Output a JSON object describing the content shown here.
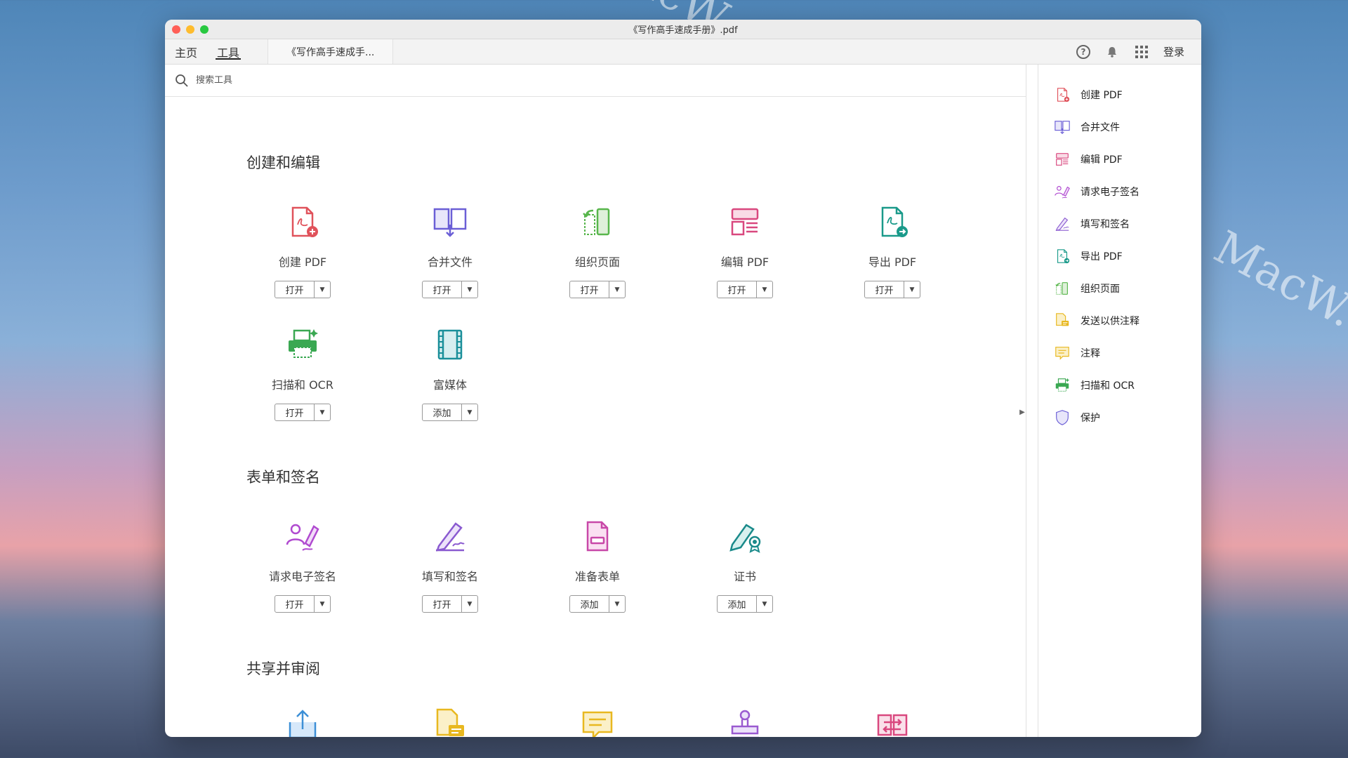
{
  "window": {
    "title": "《写作高手速成手册》.pdf"
  },
  "menubar": {
    "tabs": [
      {
        "label": "主页"
      },
      {
        "label": "工具"
      }
    ],
    "doc_tab": "《写作高手速成手...",
    "help_icon": "question-circle-icon",
    "help_glyph": "?",
    "login": "登录"
  },
  "search": {
    "placeholder": "搜索工具"
  },
  "sections": [
    {
      "title": "创建和编辑",
      "tools": [
        {
          "label": "创建 PDF",
          "button": "打开",
          "icon": "create-pdf-icon",
          "color": "#e0525b"
        },
        {
          "label": "合并文件",
          "button": "打开",
          "icon": "combine-files-icon",
          "color": "#6b5fd6"
        },
        {
          "label": "组织页面",
          "button": "打开",
          "icon": "organize-pages-icon",
          "color": "#58b64c"
        },
        {
          "label": "编辑 PDF",
          "button": "打开",
          "icon": "edit-pdf-icon",
          "color": "#d9487f"
        },
        {
          "label": "导出 PDF",
          "button": "打开",
          "icon": "export-pdf-icon",
          "color": "#1a9a8a"
        },
        {
          "label": "扫描和 OCR",
          "button": "打开",
          "icon": "scan-ocr-icon",
          "color": "#3aa852"
        },
        {
          "label": "富媒体",
          "button": "添加",
          "icon": "rich-media-icon",
          "color": "#1a8f9a"
        }
      ]
    },
    {
      "title": "表单和签名",
      "tools": [
        {
          "label": "请求电子签名",
          "button": "打开",
          "icon": "request-esign-icon",
          "color": "#b04ad0"
        },
        {
          "label": "填写和签名",
          "button": "打开",
          "icon": "fill-sign-icon",
          "color": "#8a5ad0"
        },
        {
          "label": "准备表单",
          "button": "添加",
          "icon": "prepare-form-icon",
          "color": "#c848a8"
        },
        {
          "label": "证书",
          "button": "添加",
          "icon": "certificate-icon",
          "color": "#1a8a8a"
        }
      ]
    },
    {
      "title": "共享并审阅",
      "tools": [
        {
          "label": "",
          "icon": "share-icon",
          "color": "#3d8fd6"
        },
        {
          "label": "",
          "icon": "send-comment-icon",
          "color": "#e8b820"
        },
        {
          "label": "",
          "icon": "comment-icon",
          "color": "#e8b820"
        },
        {
          "label": "",
          "icon": "stamp-icon",
          "color": "#9a5ad0"
        },
        {
          "label": "",
          "icon": "compare-icon",
          "color": "#d9487f"
        }
      ]
    }
  ],
  "sidebar": {
    "items": [
      {
        "label": "创建 PDF",
        "icon": "create-pdf-icon",
        "color": "#e0525b"
      },
      {
        "label": "合并文件",
        "icon": "combine-files-icon",
        "color": "#6b5fd6"
      },
      {
        "label": "编辑 PDF",
        "icon": "edit-pdf-icon",
        "color": "#d9487f"
      },
      {
        "label": "请求电子签名",
        "icon": "request-esign-icon",
        "color": "#b04ad0"
      },
      {
        "label": "填写和签名",
        "icon": "fill-sign-icon",
        "color": "#8a5ad0"
      },
      {
        "label": "导出 PDF",
        "icon": "export-pdf-icon",
        "color": "#1a9a8a"
      },
      {
        "label": "组织页面",
        "icon": "organize-pages-icon",
        "color": "#58b64c"
      },
      {
        "label": "发送以供注释",
        "icon": "send-comment-icon",
        "color": "#e8b820"
      },
      {
        "label": "注释",
        "icon": "comment-icon",
        "color": "#e8b820"
      },
      {
        "label": "扫描和 OCR",
        "icon": "scan-ocr-icon",
        "color": "#3aa852"
      },
      {
        "label": "保护",
        "icon": "protect-icon",
        "color": "#6b5fd6"
      }
    ]
  },
  "collapse_glyph": "▶",
  "chevron_glyph": "▼"
}
